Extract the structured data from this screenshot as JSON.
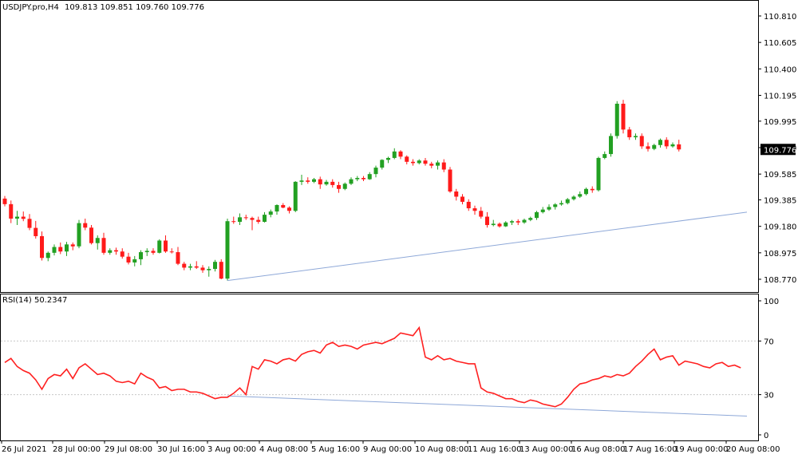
{
  "header": {
    "symbol": "USDJPY.pro,H4",
    "ohlc": "109.813 109.851 109.760 109.776"
  },
  "rsi_header": {
    "label": "RSI(14) 50.2347"
  },
  "colors": {
    "bull": "#22a022",
    "bear": "#ff1a1a",
    "trendline": "#8ea8d8",
    "rsi_line": "#ff2020",
    "current_price_bg": "#000000",
    "current_price_text": "#ffffff"
  },
  "chart_data": [
    {
      "type": "candlestick",
      "title": "USDJPY.pro,H4",
      "current_price_label": "109.776",
      "y_ticks": [
        "110.810",
        "110.605",
        "110.400",
        "110.195",
        "109.995",
        "109.790",
        "109.585",
        "109.385",
        "109.180",
        "108.975",
        "108.770"
      ],
      "ylim": [
        108.73,
        110.85
      ],
      "candles": [
        {
          "o": 109.395,
          "h": 109.415,
          "l": 109.335,
          "c": 109.352
        },
        {
          "o": 109.352,
          "h": 109.38,
          "l": 109.205,
          "c": 109.24
        },
        {
          "o": 109.24,
          "h": 109.3,
          "l": 109.19,
          "c": 109.255
        },
        {
          "o": 109.255,
          "h": 109.295,
          "l": 109.22,
          "c": 109.238
        },
        {
          "o": 109.238,
          "h": 109.275,
          "l": 109.15,
          "c": 109.168
        },
        {
          "o": 109.168,
          "h": 109.222,
          "l": 109.085,
          "c": 109.104
        },
        {
          "o": 109.104,
          "h": 109.14,
          "l": 108.915,
          "c": 108.935
        },
        {
          "o": 108.935,
          "h": 108.985,
          "l": 108.91,
          "c": 108.975
        },
        {
          "o": 108.975,
          "h": 109.04,
          "l": 108.955,
          "c": 109.02
        },
        {
          "o": 109.02,
          "h": 109.055,
          "l": 108.965,
          "c": 108.985
        },
        {
          "o": 108.985,
          "h": 109.06,
          "l": 108.95,
          "c": 109.04
        },
        {
          "o": 109.04,
          "h": 109.055,
          "l": 108.995,
          "c": 109.025
        },
        {
          "o": 109.025,
          "h": 109.23,
          "l": 109.01,
          "c": 109.205
        },
        {
          "o": 109.205,
          "h": 109.24,
          "l": 109.15,
          "c": 109.17
        },
        {
          "o": 109.17,
          "h": 109.19,
          "l": 109.04,
          "c": 109.05
        },
        {
          "o": 109.05,
          "h": 109.11,
          "l": 109.0,
          "c": 109.09
        },
        {
          "o": 109.09,
          "h": 109.13,
          "l": 108.96,
          "c": 108.975
        },
        {
          "o": 108.975,
          "h": 109.01,
          "l": 108.96,
          "c": 108.995
        },
        {
          "o": 108.995,
          "h": 109.015,
          "l": 108.96,
          "c": 108.985
        },
        {
          "o": 108.985,
          "h": 109.01,
          "l": 108.93,
          "c": 108.945
        },
        {
          "o": 108.945,
          "h": 108.975,
          "l": 108.885,
          "c": 108.9
        },
        {
          "o": 108.9,
          "h": 108.95,
          "l": 108.87,
          "c": 108.925
        },
        {
          "o": 108.925,
          "h": 108.995,
          "l": 108.88,
          "c": 108.98
        },
        {
          "o": 108.98,
          "h": 109.01,
          "l": 108.95,
          "c": 108.99
        },
        {
          "o": 108.99,
          "h": 109.01,
          "l": 108.96,
          "c": 108.975
        },
        {
          "o": 108.975,
          "h": 109.08,
          "l": 108.97,
          "c": 109.07
        },
        {
          "o": 109.07,
          "h": 109.11,
          "l": 108.975,
          "c": 108.985
        },
        {
          "o": 108.985,
          "h": 109.01,
          "l": 108.97,
          "c": 108.98
        },
        {
          "o": 108.98,
          "h": 109.02,
          "l": 108.88,
          "c": 108.89
        },
        {
          "o": 108.89,
          "h": 108.905,
          "l": 108.84,
          "c": 108.86
        },
        {
          "o": 108.86,
          "h": 108.89,
          "l": 108.84,
          "c": 108.87
        },
        {
          "o": 108.87,
          "h": 108.91,
          "l": 108.85,
          "c": 108.86
        },
        {
          "o": 108.86,
          "h": 108.88,
          "l": 108.82,
          "c": 108.84
        },
        {
          "o": 108.84,
          "h": 108.87,
          "l": 108.79,
          "c": 108.85
        },
        {
          "o": 108.85,
          "h": 108.92,
          "l": 108.83,
          "c": 108.905
        },
        {
          "o": 108.905,
          "h": 108.925,
          "l": 108.77,
          "c": 108.775
        },
        {
          "o": 108.775,
          "h": 109.24,
          "l": 108.76,
          "c": 109.22
        },
        {
          "o": 109.22,
          "h": 109.255,
          "l": 109.2,
          "c": 109.215
        },
        {
          "o": 109.215,
          "h": 109.28,
          "l": 109.19,
          "c": 109.25
        },
        {
          "o": 109.25,
          "h": 109.27,
          "l": 109.23,
          "c": 109.245
        },
        {
          "o": 109.245,
          "h": 109.255,
          "l": 109.15,
          "c": 109.23
        },
        {
          "o": 109.23,
          "h": 109.255,
          "l": 109.2,
          "c": 109.215
        },
        {
          "o": 109.215,
          "h": 109.29,
          "l": 109.21,
          "c": 109.27
        },
        {
          "o": 109.27,
          "h": 109.31,
          "l": 109.25,
          "c": 109.295
        },
        {
          "o": 109.295,
          "h": 109.35,
          "l": 109.27,
          "c": 109.345
        },
        {
          "o": 109.345,
          "h": 109.36,
          "l": 109.32,
          "c": 109.325
        },
        {
          "o": 109.325,
          "h": 109.335,
          "l": 109.28,
          "c": 109.3
        },
        {
          "o": 109.3,
          "h": 109.53,
          "l": 109.29,
          "c": 109.525
        },
        {
          "o": 109.525,
          "h": 109.58,
          "l": 109.5,
          "c": 109.535
        },
        {
          "o": 109.535,
          "h": 109.56,
          "l": 109.51,
          "c": 109.525
        },
        {
          "o": 109.525,
          "h": 109.555,
          "l": 109.515,
          "c": 109.545
        },
        {
          "o": 109.545,
          "h": 109.565,
          "l": 109.47,
          "c": 109.505
        },
        {
          "o": 109.505,
          "h": 109.54,
          "l": 109.495,
          "c": 109.525
        },
        {
          "o": 109.525,
          "h": 109.545,
          "l": 109.48,
          "c": 109.5
        },
        {
          "o": 109.5,
          "h": 109.525,
          "l": 109.44,
          "c": 109.47
        },
        {
          "o": 109.47,
          "h": 109.52,
          "l": 109.46,
          "c": 109.51
        },
        {
          "o": 109.51,
          "h": 109.56,
          "l": 109.5,
          "c": 109.545
        },
        {
          "o": 109.545,
          "h": 109.57,
          "l": 109.53,
          "c": 109.555
        },
        {
          "o": 109.555,
          "h": 109.57,
          "l": 109.53,
          "c": 109.545
        },
        {
          "o": 109.545,
          "h": 109.6,
          "l": 109.54,
          "c": 109.585
        },
        {
          "o": 109.585,
          "h": 109.65,
          "l": 109.56,
          "c": 109.635
        },
        {
          "o": 109.635,
          "h": 109.7,
          "l": 109.62,
          "c": 109.695
        },
        {
          "o": 109.695,
          "h": 109.72,
          "l": 109.67,
          "c": 109.71
        },
        {
          "o": 109.71,
          "h": 109.785,
          "l": 109.7,
          "c": 109.76
        },
        {
          "o": 109.76,
          "h": 109.77,
          "l": 109.7,
          "c": 109.72
        },
        {
          "o": 109.72,
          "h": 109.73,
          "l": 109.66,
          "c": 109.68
        },
        {
          "o": 109.68,
          "h": 109.7,
          "l": 109.65,
          "c": 109.67
        },
        {
          "o": 109.67,
          "h": 109.7,
          "l": 109.66,
          "c": 109.69
        },
        {
          "o": 109.69,
          "h": 109.71,
          "l": 109.65,
          "c": 109.665
        },
        {
          "o": 109.665,
          "h": 109.68,
          "l": 109.63,
          "c": 109.65
        },
        {
          "o": 109.65,
          "h": 109.69,
          "l": 109.62,
          "c": 109.675
        },
        {
          "o": 109.675,
          "h": 109.7,
          "l": 109.6,
          "c": 109.62
        },
        {
          "o": 109.62,
          "h": 109.64,
          "l": 109.44,
          "c": 109.45
        },
        {
          "o": 109.45,
          "h": 109.47,
          "l": 109.38,
          "c": 109.41
        },
        {
          "o": 109.41,
          "h": 109.43,
          "l": 109.35,
          "c": 109.37
        },
        {
          "o": 109.37,
          "h": 109.39,
          "l": 109.3,
          "c": 109.32
        },
        {
          "o": 109.32,
          "h": 109.34,
          "l": 109.27,
          "c": 109.3
        },
        {
          "o": 109.3,
          "h": 109.33,
          "l": 109.24,
          "c": 109.255
        },
        {
          "o": 109.255,
          "h": 109.29,
          "l": 109.17,
          "c": 109.19
        },
        {
          "o": 109.19,
          "h": 109.23,
          "l": 109.18,
          "c": 109.2
        },
        {
          "o": 109.2,
          "h": 109.21,
          "l": 109.17,
          "c": 109.18
        },
        {
          "o": 109.18,
          "h": 109.22,
          "l": 109.175,
          "c": 109.21
        },
        {
          "o": 109.21,
          "h": 109.23,
          "l": 109.19,
          "c": 109.22
        },
        {
          "o": 109.22,
          "h": 109.235,
          "l": 109.19,
          "c": 109.21
        },
        {
          "o": 109.21,
          "h": 109.24,
          "l": 109.2,
          "c": 109.23
        },
        {
          "o": 109.23,
          "h": 109.255,
          "l": 109.22,
          "c": 109.245
        },
        {
          "o": 109.245,
          "h": 109.3,
          "l": 109.23,
          "c": 109.29
        },
        {
          "o": 109.29,
          "h": 109.33,
          "l": 109.28,
          "c": 109.31
        },
        {
          "o": 109.31,
          "h": 109.35,
          "l": 109.3,
          "c": 109.33
        },
        {
          "o": 109.33,
          "h": 109.36,
          "l": 109.31,
          "c": 109.35
        },
        {
          "o": 109.35,
          "h": 109.38,
          "l": 109.34,
          "c": 109.36
        },
        {
          "o": 109.36,
          "h": 109.4,
          "l": 109.35,
          "c": 109.39
        },
        {
          "o": 109.39,
          "h": 109.42,
          "l": 109.38,
          "c": 109.41
        },
        {
          "o": 109.41,
          "h": 109.45,
          "l": 109.4,
          "c": 109.43
        },
        {
          "o": 109.43,
          "h": 109.48,
          "l": 109.42,
          "c": 109.47
        },
        {
          "o": 109.47,
          "h": 109.49,
          "l": 109.44,
          "c": 109.46
        },
        {
          "o": 109.46,
          "h": 109.72,
          "l": 109.45,
          "c": 109.71
        },
        {
          "o": 109.71,
          "h": 109.76,
          "l": 109.7,
          "c": 109.74
        },
        {
          "o": 109.74,
          "h": 109.9,
          "l": 109.72,
          "c": 109.88
        },
        {
          "o": 109.88,
          "h": 110.15,
          "l": 109.86,
          "c": 110.13
        },
        {
          "o": 110.13,
          "h": 110.16,
          "l": 109.9,
          "c": 109.93
        },
        {
          "o": 109.93,
          "h": 109.95,
          "l": 109.85,
          "c": 109.87
        },
        {
          "o": 109.87,
          "h": 109.9,
          "l": 109.85,
          "c": 109.88
        },
        {
          "o": 109.88,
          "h": 109.9,
          "l": 109.78,
          "c": 109.8
        },
        {
          "o": 109.8,
          "h": 109.83,
          "l": 109.76,
          "c": 109.78
        },
        {
          "o": 109.78,
          "h": 109.82,
          "l": 109.77,
          "c": 109.81
        },
        {
          "o": 109.81,
          "h": 109.86,
          "l": 109.79,
          "c": 109.85
        },
        {
          "o": 109.85,
          "h": 109.87,
          "l": 109.78,
          "c": 109.8
        },
        {
          "o": 109.8,
          "h": 109.83,
          "l": 109.79,
          "c": 109.815
        },
        {
          "o": 109.815,
          "h": 109.851,
          "l": 109.76,
          "c": 109.776
        }
      ],
      "trendline": {
        "from_index": 36,
        "from_price": 108.76,
        "to_index": 120,
        "to_price": 109.29
      }
    },
    {
      "type": "line",
      "title": "RSI(14) 50.2347",
      "y_ticks": [
        "100",
        "70",
        "30",
        "0"
      ],
      "ylim": [
        0,
        100
      ],
      "x_ticks": [
        "26 Jul 2021",
        "28 Jul 00:00",
        "29 Jul 08:00",
        "30 Jul 16:00",
        "3 Aug 00:00",
        "4 Aug 08:00",
        "5 Aug 16:00",
        "9 Aug 00:00",
        "10 Aug 08:00",
        "11 Aug 16:00",
        "13 Aug 00:00",
        "16 Aug 08:00",
        "17 Aug 16:00",
        "19 Aug 00:00",
        "20 Aug 08:00"
      ],
      "values": [
        54,
        57,
        51,
        48,
        46,
        41,
        34,
        42,
        45,
        44,
        49,
        42,
        50,
        53,
        49,
        45,
        46,
        44,
        40,
        39,
        40,
        38,
        46,
        43,
        41,
        35,
        36,
        33,
        34,
        34,
        32,
        32,
        31,
        29,
        27,
        28,
        28,
        31,
        35,
        30,
        51,
        49,
        56,
        55,
        53,
        56,
        57,
        55,
        60,
        62,
        63,
        61,
        67,
        69,
        66,
        67,
        66,
        64,
        67,
        68,
        69,
        68,
        70,
        72,
        76,
        75,
        74,
        80,
        58,
        56,
        59,
        56,
        57,
        55,
        54,
        53,
        53,
        35,
        32,
        31,
        29,
        27,
        27,
        25,
        24,
        26,
        25,
        23,
        22,
        21,
        23,
        28,
        34,
        38,
        39,
        41,
        42,
        44,
        43,
        45,
        44,
        46,
        51,
        55,
        60,
        64,
        56,
        58,
        59,
        52,
        55,
        54,
        53,
        51,
        50,
        53,
        54,
        51,
        52,
        50
      ],
      "levels": [
        70,
        30
      ],
      "trendline": {
        "from_index": 36,
        "from_value": 29,
        "to_index": 120,
        "to_value": 14
      }
    }
  ]
}
